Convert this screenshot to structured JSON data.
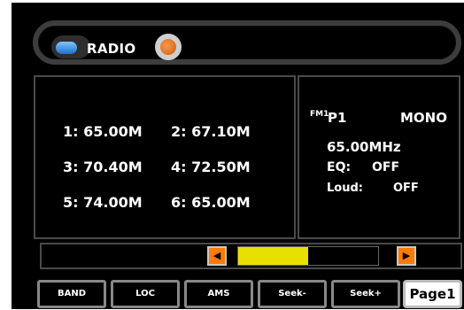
{
  "header": {
    "title": "RADIO"
  },
  "presets": [
    {
      "label": "1:  65.00M"
    },
    {
      "label": "2:  67.10M"
    },
    {
      "label": "3:  70.40M"
    },
    {
      "label": "4:  72.50M"
    },
    {
      "label": "5:  74.00M"
    },
    {
      "label": "6:  65.00M"
    }
  ],
  "status": {
    "band": "FM1",
    "preset": "P1",
    "stereo": "MONO",
    "frequency": "65.00MHz",
    "eq_label": "EQ:",
    "eq_value": "OFF",
    "loud_label": "Loud:",
    "loud_value": "OFF"
  },
  "tuning": {
    "level": 0.5
  },
  "softkeys": [
    "BAND",
    "LOC",
    "AMS",
    "Seek-",
    "Seek+",
    "Page1"
  ],
  "colors": {
    "accent": "#ff7a00",
    "progress": "#e8e000",
    "background": "#000000"
  }
}
